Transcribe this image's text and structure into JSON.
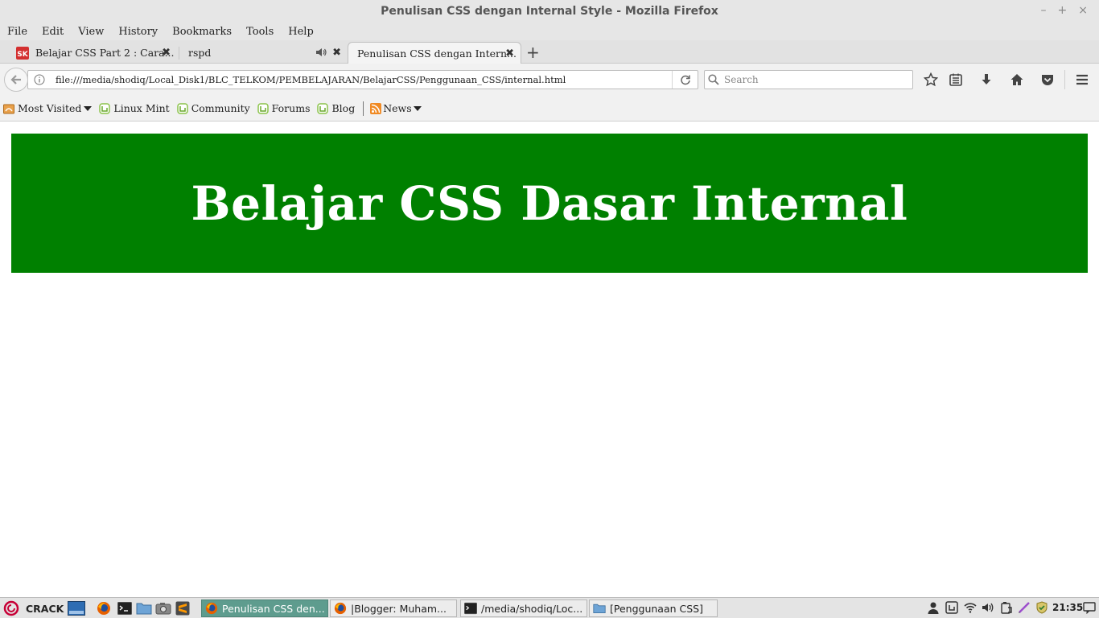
{
  "window": {
    "title": "Penulisan CSS dengan Internal Style - Mozilla Firefox",
    "controls": [
      "–",
      "+",
      "×"
    ]
  },
  "menu": [
    "File",
    "Edit",
    "View",
    "History",
    "Bookmarks",
    "Tools",
    "Help"
  ],
  "tabs": [
    {
      "label": "Belajar CSS Part 2 : Cara...",
      "favicon": "sk-logo-icon",
      "close": "✖"
    },
    {
      "label": "rspd",
      "favicon": "none",
      "audio": "speaker-icon",
      "close": "✖"
    },
    {
      "label": "Penulisan CSS dengan Intern...",
      "favicon": "none",
      "close": "✖",
      "active": true
    }
  ],
  "new_tab_label": "+",
  "navbar": {
    "url": "file:///media/shodiq/Local_Disk1/BLC_TELKOM/PEMBELAJARAN/BelajarCSS/Penggunaan_CSS/internal.html",
    "search_placeholder": "Search"
  },
  "bookmarks": [
    {
      "label": "Most Visited",
      "icon": "folder-icon",
      "dropdown": true
    },
    {
      "label": "Linux Mint",
      "icon": "mint-icon"
    },
    {
      "label": "Community",
      "icon": "mint-icon"
    },
    {
      "label": "Forums",
      "icon": "mint-icon"
    },
    {
      "label": "Blog",
      "icon": "mint-icon"
    },
    {
      "label": "News",
      "icon": "rss-icon",
      "dropdown": true
    }
  ],
  "page": {
    "heading": "Belajar CSS Dasar Internal",
    "banner_color": "#008000",
    "heading_color": "#ffffff"
  },
  "taskbar": {
    "start_label": "CRACK",
    "tasks": [
      {
        "label": "Penulisan CSS den...",
        "icon": "firefox-icon",
        "active": true
      },
      {
        "label": "|Blogger: Muham...",
        "icon": "firefox-icon"
      },
      {
        "label": "/media/shodiq/Loc...",
        "icon": "terminal-icon"
      },
      {
        "label": "[Penggunaan CSS]",
        "icon": "folder-icon"
      }
    ],
    "clock": "21:35"
  }
}
